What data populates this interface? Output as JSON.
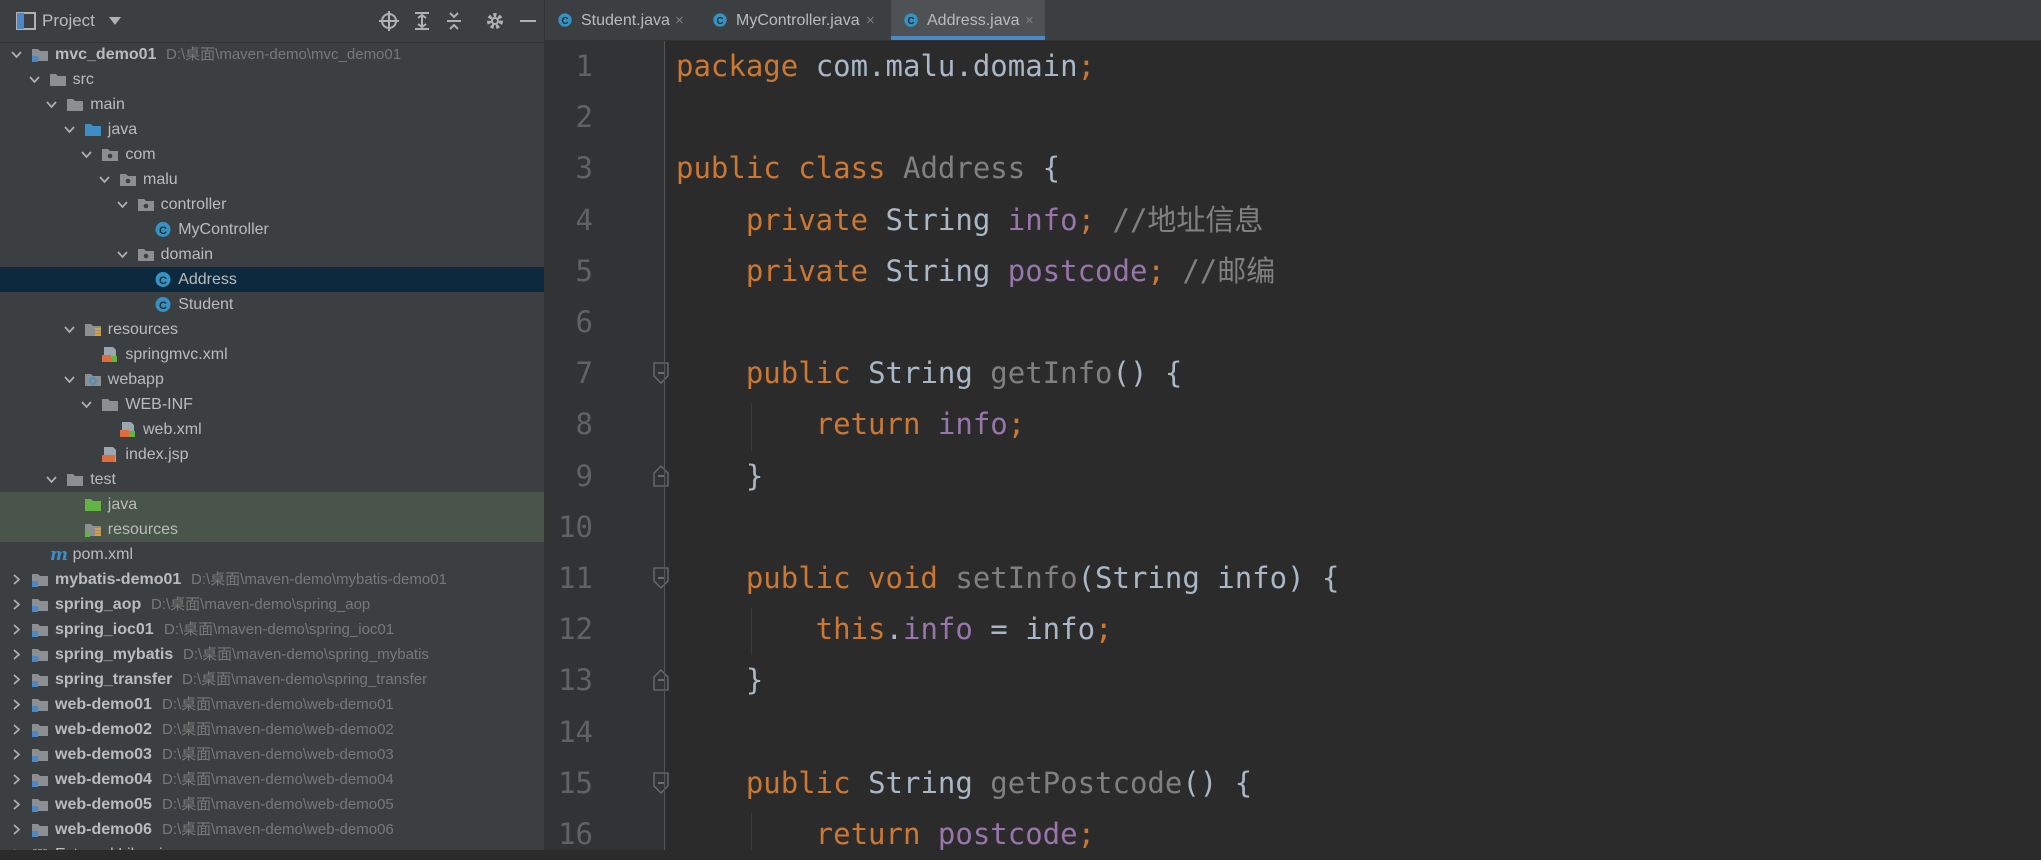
{
  "project_panel": {
    "title": "Project",
    "tree": [
      {
        "label": "mvc_demo01",
        "path": "D:\\桌面\\maven-demo\\mvc_demo01",
        "bold": true,
        "depth": 0,
        "arrow": "down",
        "icon": "module-folder-icon"
      },
      {
        "label": "src",
        "depth": 1,
        "arrow": "down",
        "icon": "folder-icon"
      },
      {
        "label": "main",
        "depth": 2,
        "arrow": "down",
        "icon": "folder-icon"
      },
      {
        "label": "java",
        "depth": 3,
        "arrow": "down",
        "icon": "source-folder-icon"
      },
      {
        "label": "com",
        "depth": 4,
        "arrow": "down",
        "icon": "package-icon"
      },
      {
        "label": "malu",
        "depth": 5,
        "arrow": "down",
        "icon": "package-icon"
      },
      {
        "label": "controller",
        "depth": 6,
        "arrow": "down",
        "icon": "package-icon"
      },
      {
        "label": "MyController",
        "depth": 7,
        "icon": "java-class-icon"
      },
      {
        "label": "domain",
        "depth": 6,
        "arrow": "down",
        "icon": "package-icon"
      },
      {
        "label": "Address",
        "depth": 7,
        "icon": "java-class-icon",
        "selected": true
      },
      {
        "label": "Student",
        "depth": 7,
        "icon": "java-class-icon"
      },
      {
        "label": "resources",
        "depth": 3,
        "arrow": "down",
        "icon": "resources-folder-icon"
      },
      {
        "label": "springmvc.xml",
        "depth": 4,
        "icon": "xml-file-icon"
      },
      {
        "label": "webapp",
        "depth": 3,
        "arrow": "down",
        "icon": "web-folder-icon"
      },
      {
        "label": "WEB-INF",
        "depth": 4,
        "arrow": "down",
        "icon": "folder-icon"
      },
      {
        "label": "web.xml",
        "depth": 5,
        "icon": "xml-file-icon"
      },
      {
        "label": "index.jsp",
        "depth": 4,
        "icon": "jsp-file-icon"
      },
      {
        "label": "test",
        "depth": 2,
        "arrow": "down",
        "icon": "folder-icon"
      },
      {
        "label": "java",
        "depth": 3,
        "icon": "test-source-folder-icon",
        "test": true
      },
      {
        "label": "resources",
        "depth": 3,
        "icon": "test-resources-folder-icon",
        "test": true
      },
      {
        "label": "pom.xml",
        "depth": 1,
        "icon": "maven-icon"
      },
      {
        "label": "mybatis-demo01",
        "path": "D:\\桌面\\maven-demo\\mybatis-demo01",
        "bold": true,
        "depth": 0,
        "arrow": "right",
        "icon": "module-folder-icon"
      },
      {
        "label": "spring_aop",
        "path": "D:\\桌面\\maven-demo\\spring_aop",
        "bold": true,
        "depth": 0,
        "arrow": "right",
        "icon": "module-folder-icon"
      },
      {
        "label": "spring_ioc01",
        "path": "D:\\桌面\\maven-demo\\spring_ioc01",
        "bold": true,
        "depth": 0,
        "arrow": "right",
        "icon": "module-folder-icon"
      },
      {
        "label": "spring_mybatis",
        "path": "D:\\桌面\\maven-demo\\spring_mybatis",
        "bold": true,
        "depth": 0,
        "arrow": "right",
        "icon": "module-folder-icon"
      },
      {
        "label": "spring_transfer",
        "path": "D:\\桌面\\maven-demo\\spring_transfer",
        "bold": true,
        "depth": 0,
        "arrow": "right",
        "icon": "module-folder-icon"
      },
      {
        "label": "web-demo01",
        "path": "D:\\桌面\\maven-demo\\web-demo01",
        "bold": true,
        "depth": 0,
        "arrow": "right",
        "icon": "module-folder-icon"
      },
      {
        "label": "web-demo02",
        "path": "D:\\桌面\\maven-demo\\web-demo02",
        "bold": true,
        "depth": 0,
        "arrow": "right",
        "icon": "module-folder-icon"
      },
      {
        "label": "web-demo03",
        "path": "D:\\桌面\\maven-demo\\web-demo03",
        "bold": true,
        "depth": 0,
        "arrow": "right",
        "icon": "module-folder-icon"
      },
      {
        "label": "web-demo04",
        "path": "D:\\桌面\\maven-demo\\web-demo04",
        "bold": true,
        "depth": 0,
        "arrow": "right",
        "icon": "module-folder-icon"
      },
      {
        "label": "web-demo05",
        "path": "D:\\桌面\\maven-demo\\web-demo05",
        "bold": true,
        "depth": 0,
        "arrow": "right",
        "icon": "module-folder-icon"
      },
      {
        "label": "web-demo06",
        "path": "D:\\桌面\\maven-demo\\web-demo06",
        "bold": true,
        "depth": 0,
        "arrow": "right",
        "icon": "module-folder-icon"
      },
      {
        "label": "External Libraries",
        "depth": 0,
        "arrow": "right",
        "icon": "library-icon"
      }
    ]
  },
  "tabs": [
    {
      "label": "Student.java",
      "close": "×",
      "active": false
    },
    {
      "label": "MyController.java",
      "close": "×",
      "active": false
    },
    {
      "label": "Address.java",
      "close": "×",
      "active": true
    }
  ],
  "editor": {
    "line_numbers": [
      "1",
      "2",
      "3",
      "4",
      "5",
      "6",
      "7",
      "8",
      "9",
      "10",
      "11",
      "12",
      "13",
      "14",
      "15",
      "16"
    ],
    "code_lines": [
      [
        {
          "t": "package ",
          "s": "k"
        },
        {
          "t": "com.malu.domain",
          "s": ""
        },
        {
          "t": ";",
          "s": "k"
        }
      ],
      [],
      [
        {
          "t": "public class ",
          "s": "k"
        },
        {
          "t": "Address",
          "s": "g"
        },
        {
          "t": " {",
          "s": ""
        }
      ],
      [
        {
          "t": "    private ",
          "s": "k"
        },
        {
          "t": "String ",
          "s": ""
        },
        {
          "t": "info",
          "s": "f"
        },
        {
          "t": "; ",
          "s": "k"
        },
        {
          "t": "//地址信息",
          "s": "c"
        }
      ],
      [
        {
          "t": "    private ",
          "s": "k"
        },
        {
          "t": "String ",
          "s": ""
        },
        {
          "t": "postcode",
          "s": "f"
        },
        {
          "t": "; ",
          "s": "k"
        },
        {
          "t": "//邮编",
          "s": "c"
        }
      ],
      [],
      [
        {
          "t": "    public ",
          "s": "k"
        },
        {
          "t": "String ",
          "s": ""
        },
        {
          "t": "getInfo",
          "s": "g"
        },
        {
          "t": "() {",
          "s": ""
        }
      ],
      [
        {
          "t": "        return ",
          "s": "k"
        },
        {
          "t": "info",
          "s": "f"
        },
        {
          "t": ";",
          "s": "k"
        }
      ],
      [
        {
          "t": "    }",
          "s": ""
        }
      ],
      [],
      [
        {
          "t": "    public void ",
          "s": "k"
        },
        {
          "t": "setInfo",
          "s": "g"
        },
        {
          "t": "(String info) {",
          "s": ""
        }
      ],
      [
        {
          "t": "        this",
          "s": "k"
        },
        {
          "t": ".",
          "s": ""
        },
        {
          "t": "info",
          "s": "f"
        },
        {
          "t": " = info",
          "s": ""
        },
        {
          "t": ";",
          "s": "k"
        }
      ],
      [
        {
          "t": "    }",
          "s": ""
        }
      ],
      [],
      [
        {
          "t": "    public ",
          "s": "k"
        },
        {
          "t": "String ",
          "s": ""
        },
        {
          "t": "getPostcode",
          "s": "g"
        },
        {
          "t": "() {",
          "s": ""
        }
      ],
      [
        {
          "t": "        return ",
          "s": "k"
        },
        {
          "t": "postcode",
          "s": "f"
        },
        {
          "t": ";",
          "s": "k"
        }
      ]
    ]
  }
}
